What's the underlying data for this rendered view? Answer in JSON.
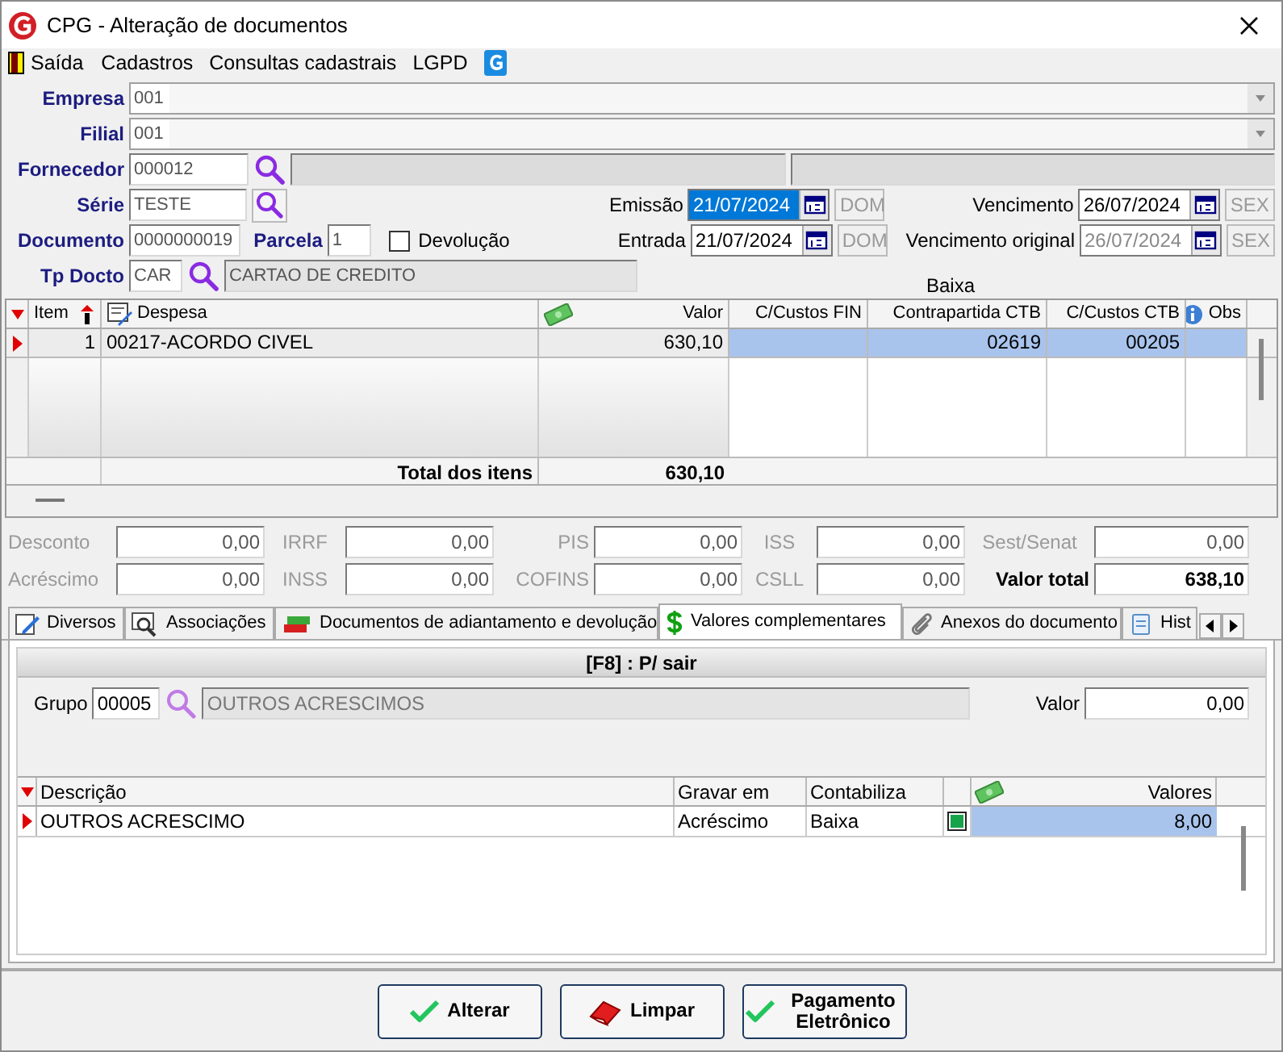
{
  "window": {
    "title": "CPG - Alteração de documentos"
  },
  "menu": [
    {
      "label": "Saída",
      "kind": "exit"
    },
    {
      "label": "Cadastros",
      "kind": "text"
    },
    {
      "label": "Consultas cadastrais",
      "kind": "text"
    },
    {
      "label": "LGPD",
      "kind": "text"
    },
    {
      "kind": "logo"
    }
  ],
  "header": {
    "empresa": {
      "label": "Empresa",
      "code": "001"
    },
    "filial": {
      "label": "Filial",
      "code": "001"
    },
    "fornecedor": {
      "label": "Fornecedor",
      "code": "000012"
    },
    "serie": {
      "label": "Série",
      "code": "TESTE"
    },
    "documento": {
      "label": "Documento",
      "code": "0000000019"
    },
    "parcela": {
      "label": "Parcela",
      "value": "1"
    },
    "devolucao": {
      "label": "Devolução",
      "checked": false
    },
    "tp_docto": {
      "label": "Tp Docto",
      "code": "CAR",
      "description": "CARTAO DE CREDITO"
    },
    "dates": [
      {
        "label": "Emissão",
        "date": "21/07/2024",
        "weekday": "DOM",
        "text_selected": true,
        "disabled": false
      },
      {
        "label": "Vencimento",
        "date": "26/07/2024",
        "weekday": "SEX",
        "text_selected": false,
        "disabled": false
      },
      {
        "label": "Entrada",
        "date": "21/07/2024",
        "weekday": "DOM",
        "text_selected": false,
        "disabled": false
      },
      {
        "label": "Vencimento original",
        "date": "26/07/2024",
        "weekday": "SEX",
        "text_selected": false,
        "disabled": true
      }
    ],
    "baixa_label": "Baixa"
  },
  "items_grid": {
    "columns": [
      {
        "label": "Item"
      },
      {
        "label": "Despesa"
      },
      {
        "label": "Valor"
      },
      {
        "label": "C/Custos FIN"
      },
      {
        "label": "Contrapartida CTB"
      },
      {
        "label": "C/Custos CTB"
      },
      {
        "label": "Obs"
      }
    ],
    "rows": [
      {
        "item": "1",
        "despesa": "00217-ACORDO CIVEL",
        "valor": "630,10",
        "cc_fin": "",
        "contrapartida": "02619",
        "cc_ctb": "00205",
        "selected": true
      }
    ],
    "total_label": "Total dos itens",
    "total_value": "630,10"
  },
  "totals": [
    {
      "label": "Desconto",
      "value": "0,00",
      "kind": "field"
    },
    {
      "label": "IRRF",
      "value": "0,00",
      "kind": "field"
    },
    {
      "label": "PIS",
      "value": "0,00",
      "kind": "field"
    },
    {
      "label": "ISS",
      "value": "0,00",
      "kind": "field"
    },
    {
      "label": "Sest/Senat",
      "value": "0,00",
      "kind": "field"
    },
    {
      "label": "Acréscimo",
      "value": "0,00",
      "kind": "field"
    },
    {
      "label": "INSS",
      "value": "0,00",
      "kind": "field"
    },
    {
      "label": "COFINS",
      "value": "0,00",
      "kind": "field"
    },
    {
      "label": "CSLL",
      "value": "0,00",
      "kind": "field"
    },
    {
      "label": "Valor total",
      "value": "638,10",
      "kind": "total"
    }
  ],
  "tabs": [
    {
      "label": "Diversos",
      "selected": false
    },
    {
      "label": "Associações",
      "selected": false
    },
    {
      "label": "Documentos de adiantamento e devolução",
      "selected": false
    },
    {
      "label": "Valores complementares",
      "selected": true
    },
    {
      "label": "Anexos do documento",
      "selected": false
    },
    {
      "label": "Hist",
      "selected": false
    }
  ],
  "tab_panel": {
    "header": "[F8] : P/ sair",
    "grupo": {
      "label": "Grupo",
      "code": "00005",
      "description": "OUTROS ACRESCIMOS"
    },
    "valor": {
      "label": "Valor",
      "value": "0,00"
    },
    "grid": {
      "columns": [
        {
          "label": "Descrição"
        },
        {
          "label": "Gravar em"
        },
        {
          "label": "Contabiliza"
        },
        {},
        {
          "label": "Valores"
        }
      ],
      "rows": [
        {
          "descricao": "OUTROS ACRESCIMO",
          "gravar_em": "Acréscimo",
          "contabiliza": "Baixa",
          "flag": true,
          "valores": "8,00",
          "selected": true
        }
      ]
    }
  },
  "buttons": [
    {
      "label": "Alterar"
    },
    {
      "label": "Limpar"
    },
    {
      "label": "Pagamento Eletrônico"
    }
  ]
}
